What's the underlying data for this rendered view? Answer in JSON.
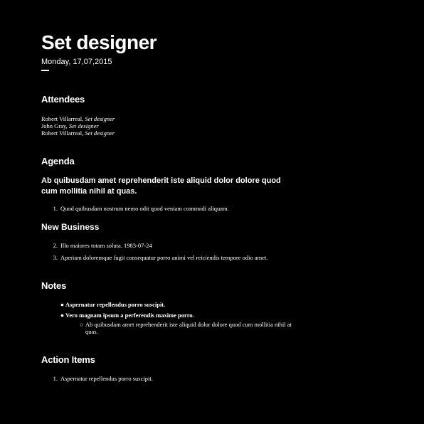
{
  "header": {
    "title": "Set designer",
    "date": "Monday, 17,07,2015"
  },
  "attendees": {
    "heading": "Attendees",
    "people": [
      {
        "name": "Robert Villarreal, ",
        "role": "Set designer"
      },
      {
        "name": "John Gray, ",
        "role": "Set designer"
      },
      {
        "name": "Robert Villarreal, ",
        "role": "Set designer"
      }
    ]
  },
  "agenda": {
    "heading": "Agenda",
    "intro": "Ab quibusdam amet reprehenderit iste aliquid dolor dolore quod cum mollitia nihil at quas.",
    "items": [
      {
        "num": "1.",
        "text": "Quod quibusdam nostrum nemo odit quod veniam commodi aliquam."
      }
    ]
  },
  "new_business": {
    "heading": "New Business",
    "items": [
      {
        "num": "2.",
        "text": "Illo maiores totam soluta. 1983-07-24"
      },
      {
        "num": "3.",
        "text": "Aperiam doloremque fugit consequatur porro animi vel reiciendis tempore odio amet."
      }
    ]
  },
  "notes": {
    "heading": "Notes",
    "bullet": "●",
    "sub_bullet": "○",
    "items": [
      {
        "text": "Aspernatur repellendus porro suscipit."
      },
      {
        "text": "Vero magnam ipsum a perferendis maxime porro."
      }
    ],
    "sub_items": [
      {
        "text": "Ab quibusdam amet reprehenderit iste aliquid dolor dolore quod cum mollitia nihil at quas."
      }
    ]
  },
  "action_items": {
    "heading": "Action Items",
    "items": [
      {
        "num": "1.",
        "text": "Aspernatur repellendus porro suscipit."
      }
    ]
  }
}
